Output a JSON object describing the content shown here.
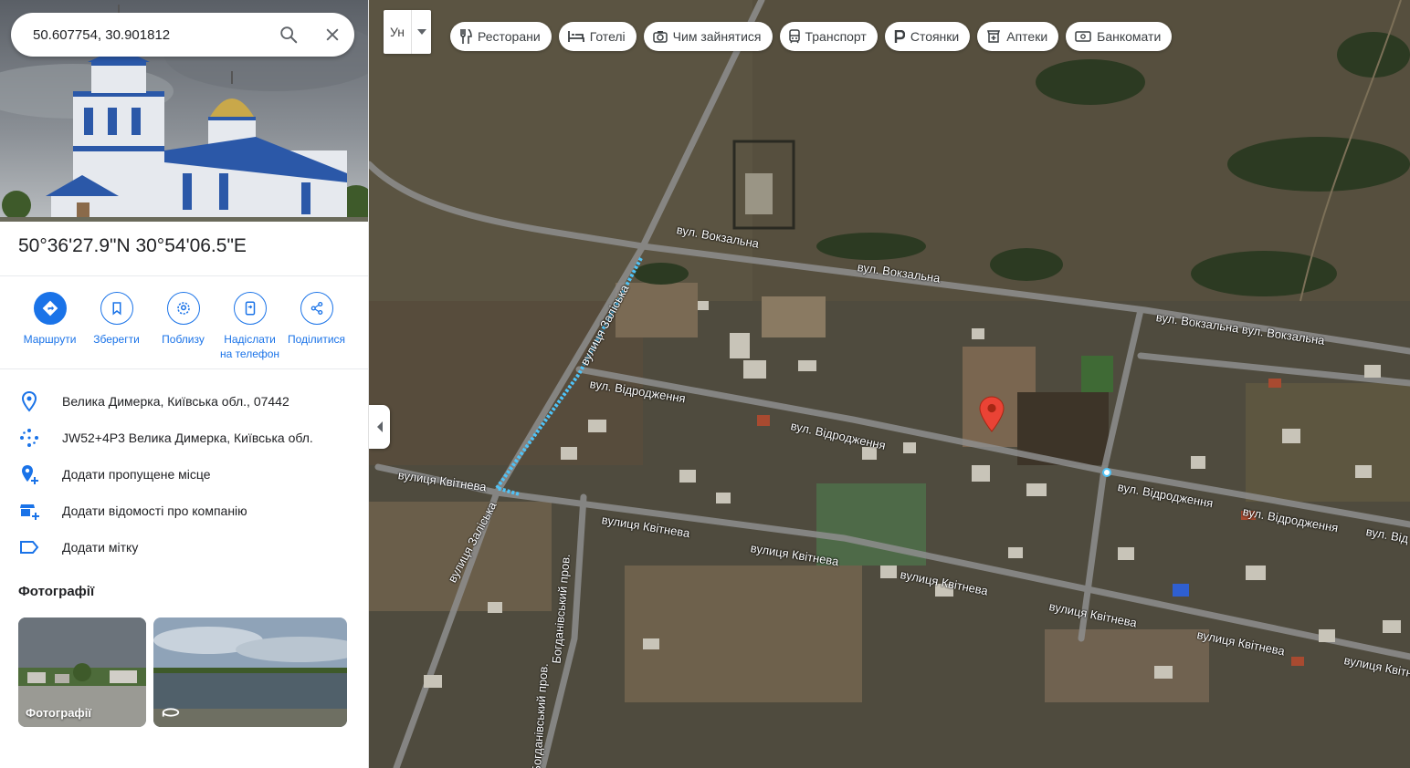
{
  "search": {
    "query": "50.607754, 30.901812"
  },
  "place": {
    "coordinates_dms": "50°36'27.9\"N 30°54'06.5\"E"
  },
  "actions": [
    {
      "label": "Маршрути"
    },
    {
      "label": "Зберегти"
    },
    {
      "label": "Поблизу"
    },
    {
      "label": "Надіслати на телефон"
    },
    {
      "label": "Поділитися"
    }
  ],
  "info": {
    "address": "Велика Димерка, Київська обл., 07442",
    "plus_code": "JW52+4P3 Велика Димерка, Київська обл.",
    "add_missing_place": "Додати пропущене місце",
    "add_business": "Додати відомості про компанію",
    "add_label": "Додати мітку"
  },
  "photos": {
    "title": "Фотографії",
    "items": [
      {
        "caption": "Фотографії"
      },
      {
        "caption": ""
      }
    ]
  },
  "map": {
    "layer_toggle_label": "Ун",
    "chips": [
      {
        "label": "Ресторани",
        "icon": "restaurant-icon"
      },
      {
        "label": "Готелі",
        "icon": "hotel-icon"
      },
      {
        "label": "Чим зайнятися",
        "icon": "camera-icon"
      },
      {
        "label": "Транспорт",
        "icon": "transit-icon"
      },
      {
        "label": "Стоянки",
        "icon": "parking-icon"
      },
      {
        "label": "Аптеки",
        "icon": "pharmacy-icon"
      },
      {
        "label": "Банкомати",
        "icon": "atm-icon"
      }
    ],
    "road_labels": {
      "vokzalna_1": "вул. Вокзальна",
      "vokzalna_2": "вул. Вокзальна",
      "vokzalna_3": "вул. Вокзальна вул. Вокзальна",
      "zaliska_1": "вулиця Заліська",
      "zaliska_2": "вулиця Заліська",
      "vidrodzhennia_1": "вул. Відродження",
      "vidrodzhennia_2": "вул. Відродження",
      "vidrodzhennia_3": "вул. Відродження",
      "vidrodzhennia_4": "вул. Відродження",
      "vidrodzhennia_5": "вул. Від",
      "kvitneva_0": "вулиця Квітнева",
      "kvitneva_1": "вулиця Квітнева",
      "kvitneva_2": "вулиця Квітнева",
      "kvitneva_3": "вулиця Квітнева",
      "kvitneva_4": "вулиця Квітнева",
      "kvitneva_5": "вулиця Квітнева",
      "kvitneva_6": "вулиця Квітне",
      "bohdanivskyi_1": "Богданівський пров.",
      "bohdanivskyi_2": "Богданівський пров."
    },
    "colors": {
      "pin": "#ea4335",
      "route": "#4fc3f7",
      "accent": "#1a73e8"
    }
  }
}
